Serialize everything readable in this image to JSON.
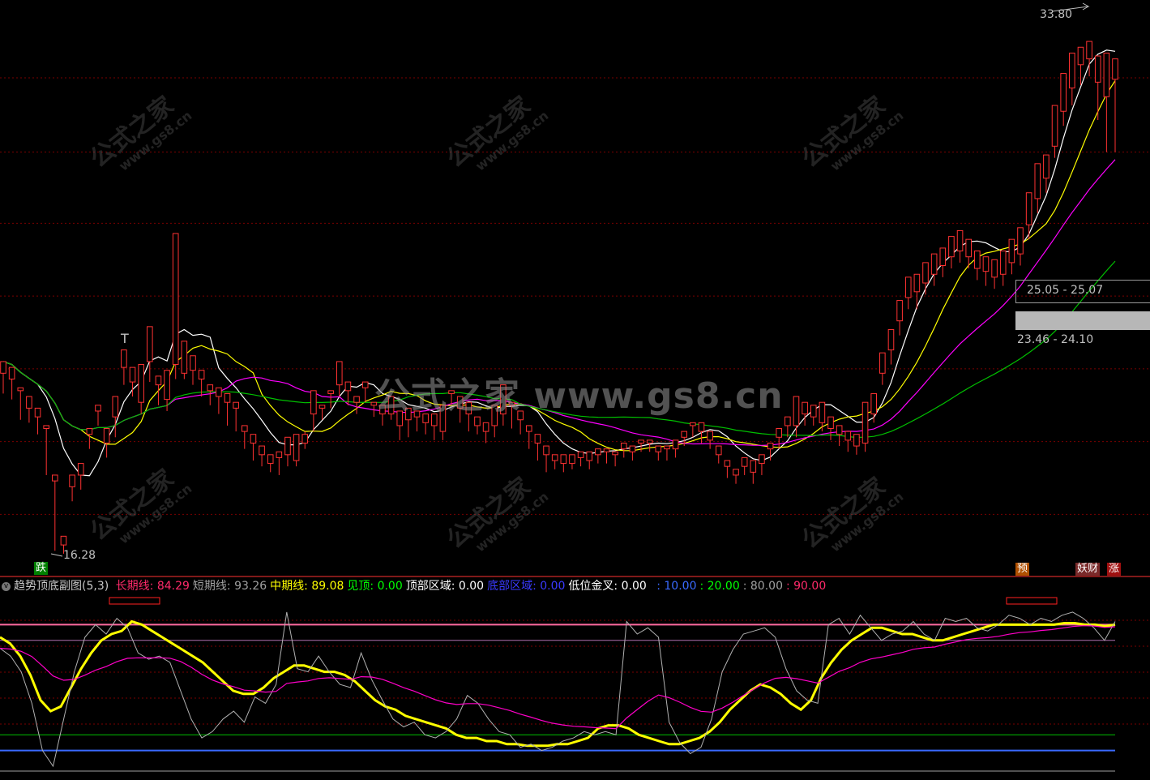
{
  "colors": {
    "background": "#000000",
    "candle_up": "#ff3232",
    "candle_down": "#54ffff",
    "ma5": "#ffffff",
    "ma10": "#ffff00",
    "ma20": "#ff00ff",
    "ma60": "#00c000",
    "grid": "#7a0000",
    "long_line": "#ffff00",
    "short_line": "#c8c8c8",
    "mid_line": "#ff00ff"
  },
  "header_strip_visible": true,
  "watermark": {
    "main": "公式之家 www.gs8.cn",
    "small_cn": "公式之家",
    "small_url": "www.gs8.cn"
  },
  "main_panel": {
    "price_labels": {
      "high": "33.80",
      "low": "16.28",
      "zone_upper": "25.05 - 25.07",
      "zone_lower": "23.46 - 24.10"
    },
    "glyph_T": "T",
    "tags": {
      "fall": "跌",
      "pre": "预",
      "weird_fin": "妖财",
      "rise": "涨"
    },
    "chart_data": {
      "type": "candlestick",
      "y_range": [
        15.5,
        35.0
      ],
      "gridlines": [
        32.55,
        30.0,
        27.55,
        25.05,
        22.55,
        20.05,
        17.55
      ],
      "candles": [
        [
          22.4,
          22.8,
          21.9,
          21.7
        ],
        [
          22.2,
          22.6,
          21.6,
          21.5
        ],
        [
          21.8,
          21.9,
          21.0,
          20.8
        ],
        [
          21.2,
          21.6,
          20.9,
          20.7
        ],
        [
          20.9,
          21.2,
          20.5,
          20.3
        ],
        [
          20.5,
          20.6,
          19.1,
          18.9
        ],
        [
          18.7,
          18.9,
          16.6,
          16.3
        ],
        [
          16.5,
          16.8,
          16.4,
          16.2
        ],
        [
          18.5,
          18.9,
          18.2,
          18.0
        ],
        [
          18.9,
          19.3,
          18.6,
          18.4
        ],
        [
          20.3,
          20.5,
          20.1,
          19.8
        ],
        [
          21.1,
          21.3,
          20.9,
          20.6
        ],
        [
          20.0,
          20.5,
          19.8,
          19.5
        ],
        [
          20.9,
          21.6,
          20.4,
          20.2
        ],
        [
          22.6,
          23.2,
          22.3,
          22.0
        ],
        [
          22.1,
          22.6,
          21.8,
          21.6
        ],
        [
          21.4,
          22.7,
          21.2,
          21.0
        ],
        [
          22.8,
          24.0,
          22.3,
          22.1
        ],
        [
          22.0,
          22.3,
          21.5,
          21.3
        ],
        [
          21.5,
          22.5,
          21.3,
          21.1
        ],
        [
          22.7,
          27.2,
          22.4,
          22.2
        ],
        [
          22.4,
          23.5,
          22.6,
          22.2
        ],
        [
          22.5,
          23.0,
          22.2,
          22.0
        ],
        [
          22.2,
          22.5,
          21.8,
          21.6
        ],
        [
          21.8,
          22.0,
          21.5,
          21.3
        ],
        [
          21.6,
          21.9,
          21.2,
          21.0
        ],
        [
          21.4,
          21.7,
          20.8,
          20.6
        ],
        [
          21.2,
          21.4,
          20.6,
          20.4
        ],
        [
          20.4,
          20.6,
          20.0,
          19.8
        ],
        [
          20.0,
          20.3,
          19.6,
          19.4
        ],
        [
          19.6,
          19.9,
          19.3,
          19.2
        ],
        [
          19.3,
          19.6,
          19.2,
          19.0
        ],
        [
          19.5,
          19.7,
          19.1,
          18.9
        ],
        [
          19.6,
          20.2,
          19.4,
          19.2
        ],
        [
          19.4,
          20.3,
          19.8,
          19.2
        ],
        [
          20.0,
          20.3,
          20.4,
          19.8
        ],
        [
          21.0,
          21.8,
          20.6,
          20.4
        ],
        [
          21.2,
          21.3,
          21.0,
          20.8
        ],
        [
          21.7,
          21.8,
          21.4,
          21.2
        ],
        [
          22.0,
          22.8,
          21.8,
          21.6
        ],
        [
          21.8,
          22.1,
          21.5,
          21.3
        ],
        [
          21.4,
          21.6,
          21.2,
          21.0
        ],
        [
          21.9,
          22.1,
          21.6,
          21.4
        ],
        [
          21.3,
          21.4,
          21.1,
          20.9
        ],
        [
          21.0,
          21.3,
          20.8,
          20.6
        ],
        [
          21.0,
          21.6,
          21.1,
          20.8
        ],
        [
          20.6,
          21.1,
          20.3,
          20.1
        ],
        [
          20.8,
          21.2,
          20.4,
          20.2
        ],
        [
          20.9,
          21.1,
          20.6,
          20.4
        ],
        [
          20.7,
          21.0,
          20.5,
          20.3
        ],
        [
          20.6,
          21.0,
          20.3,
          20.1
        ],
        [
          20.4,
          21.3,
          20.3,
          20.1
        ],
        [
          21.7,
          21.8,
          21.5,
          21.3
        ],
        [
          21.2,
          21.6,
          20.9,
          20.7
        ],
        [
          21.0,
          21.4,
          20.6,
          20.4
        ],
        [
          20.6,
          20.9,
          20.5,
          20.3
        ],
        [
          20.4,
          20.7,
          20.2,
          20.0
        ],
        [
          20.6,
          21.3,
          20.4,
          20.2
        ],
        [
          21.0,
          22.0,
          20.8,
          20.6
        ],
        [
          21.3,
          21.4,
          20.7,
          20.5
        ],
        [
          20.8,
          21.1,
          20.5,
          20.3
        ],
        [
          20.4,
          20.6,
          20.0,
          19.8
        ],
        [
          20.0,
          20.3,
          19.6,
          19.4
        ],
        [
          19.6,
          19.9,
          19.2,
          19.0
        ],
        [
          19.4,
          19.6,
          19.3,
          19.1
        ],
        [
          19.3,
          19.6,
          19.2,
          19.0
        ],
        [
          19.3,
          19.6,
          19.5,
          19.1
        ],
        [
          19.5,
          19.7,
          19.4,
          19.2
        ],
        [
          19.4,
          19.7,
          19.3,
          19.1
        ],
        [
          19.6,
          19.8,
          19.5,
          19.3
        ],
        [
          19.7,
          19.8,
          19.5,
          19.3
        ],
        [
          19.6,
          19.7,
          19.4,
          19.2
        ],
        [
          19.8,
          20.0,
          19.7,
          19.5
        ],
        [
          19.7,
          19.9,
          19.6,
          19.4
        ],
        [
          20.0,
          20.1,
          19.9,
          19.7
        ],
        [
          20.0,
          20.1,
          19.9,
          19.7
        ],
        [
          19.7,
          19.9,
          19.6,
          19.4
        ],
        [
          19.8,
          19.9,
          19.6,
          19.4
        ],
        [
          19.8,
          20.1,
          19.7,
          19.5
        ],
        [
          20.2,
          20.4,
          20.1,
          19.9
        ],
        [
          20.6,
          20.7,
          20.4,
          20.2
        ],
        [
          20.4,
          20.7,
          20.2,
          20.0
        ],
        [
          20.1,
          20.4,
          20.0,
          19.8
        ],
        [
          19.6,
          19.9,
          19.5,
          19.3
        ],
        [
          19.2,
          19.4,
          19.0,
          18.8
        ],
        [
          18.9,
          19.1,
          18.8,
          18.6
        ],
        [
          19.2,
          19.5,
          19.1,
          18.9
        ],
        [
          19.0,
          19.4,
          18.8,
          18.6
        ],
        [
          19.3,
          19.6,
          19.1,
          18.9
        ],
        [
          19.8,
          20.0,
          19.6,
          19.4
        ],
        [
          20.2,
          20.5,
          20.0,
          19.8
        ],
        [
          20.6,
          20.9,
          20.4,
          20.2
        ],
        [
          20.6,
          21.6,
          20.4,
          20.2
        ],
        [
          21.0,
          21.4,
          20.8,
          20.6
        ],
        [
          20.9,
          21.3,
          20.8,
          20.6
        ],
        [
          20.7,
          21.4,
          20.6,
          20.4
        ],
        [
          20.5,
          20.9,
          20.3,
          20.1
        ],
        [
          20.3,
          20.6,
          20.1,
          19.9
        ],
        [
          20.1,
          20.4,
          19.9,
          19.7
        ],
        [
          19.9,
          20.3,
          19.8,
          19.6
        ],
        [
          20.0,
          21.4,
          19.9,
          19.7
        ],
        [
          21.0,
          21.7,
          20.9,
          20.7
        ],
        [
          22.4,
          23.1,
          22.2,
          22.0
        ],
        [
          23.2,
          23.9,
          22.9,
          22.7
        ],
        [
          24.2,
          24.9,
          23.9,
          23.7
        ],
        [
          25.0,
          25.7,
          24.8,
          24.6
        ],
        [
          25.2,
          25.8,
          24.8,
          24.6
        ],
        [
          25.5,
          26.2,
          25.3,
          25.1
        ],
        [
          25.8,
          26.5,
          25.6,
          25.4
        ],
        [
          26.1,
          26.7,
          25.9,
          25.7
        ],
        [
          26.4,
          27.1,
          26.2,
          26.0
        ],
        [
          26.6,
          27.3,
          26.4,
          26.2
        ],
        [
          26.4,
          27.0,
          26.2,
          26.0
        ],
        [
          26.0,
          26.6,
          25.8,
          25.6
        ],
        [
          25.9,
          26.4,
          25.6,
          25.4
        ],
        [
          25.7,
          26.3,
          25.5,
          25.3
        ],
        [
          25.8,
          26.6,
          25.6,
          25.4
        ],
        [
          26.2,
          27.0,
          26.0,
          25.8
        ],
        [
          26.5,
          27.4,
          26.3,
          26.1
        ],
        [
          27.5,
          28.6,
          27.2,
          27.0
        ],
        [
          28.4,
          29.6,
          28.1,
          27.9
        ],
        [
          29.1,
          29.9,
          28.8,
          28.6
        ],
        [
          30.2,
          31.6,
          30.0,
          29.8
        ],
        [
          31.4,
          32.7,
          31.1,
          30.9
        ],
        [
          32.2,
          33.4,
          31.8,
          31.6
        ],
        [
          33.0,
          33.6,
          32.5,
          32.3
        ],
        [
          33.2,
          33.8,
          32.8,
          32.6
        ],
        [
          32.4,
          33.3,
          31.3,
          31.1
        ],
        [
          31.9,
          33.4,
          30.2,
          30.0
        ],
        [
          32.5,
          33.2,
          30.2,
          30.0
        ]
      ]
    }
  },
  "indicator_panel": {
    "title": "趋势顶底副图(5,3)",
    "legend": [
      {
        "label": "长期线:",
        "value": "84.29",
        "color": "#ff2a6a"
      },
      {
        "label": "短期线:",
        "value": "93.26",
        "color": "#a0a0a0"
      },
      {
        "label": "中期线:",
        "value": "89.08",
        "color": "#ffff00"
      },
      {
        "label": "见顶:",
        "value": "0.00",
        "color": "#00ff00"
      },
      {
        "label": "顶部区域:",
        "value": "0.00",
        "color": "#ffffff"
      },
      {
        "label": "底部区域:",
        "value": "0.00",
        "color": "#3a3aff"
      },
      {
        "label": "低位金叉:",
        "value": "0.00",
        "color": "#ffffff"
      }
    ],
    "levels": [
      {
        "value": "10.00",
        "color": "#3a6aff"
      },
      {
        "value": "20.00",
        "color": "#00ff00"
      },
      {
        "value": "80.00",
        "color": "#a0a0a0"
      },
      {
        "value": "90.00",
        "color": "#ff2a6a"
      }
    ],
    "chart_data": {
      "type": "line",
      "y_range": [
        0,
        100
      ],
      "level_lines": [
        90,
        80,
        20,
        10
      ],
      "series": [
        {
          "name": "中期线",
          "color": "#ffff00",
          "values": [
            82,
            78,
            70,
            58,
            42,
            35,
            38,
            50,
            62,
            72,
            80,
            84,
            86,
            92,
            90,
            86,
            82,
            78,
            74,
            70,
            66,
            60,
            54,
            48,
            46,
            46,
            50,
            56,
            60,
            64,
            64,
            62,
            60,
            60,
            58,
            54,
            48,
            42,
            38,
            36,
            32,
            30,
            28,
            26,
            24,
            20,
            18,
            18,
            16,
            16,
            14,
            14,
            13,
            13,
            13,
            14,
            14,
            16,
            18,
            24,
            26,
            26,
            24,
            20,
            18,
            16,
            14,
            14,
            16,
            18,
            22,
            28,
            36,
            42,
            48,
            52,
            50,
            46,
            40,
            36,
            42,
            56,
            66,
            74,
            80,
            84,
            88,
            88,
            86,
            84,
            84,
            82,
            80,
            80,
            82,
            84,
            86,
            88,
            90,
            90,
            90,
            90,
            90,
            90,
            90,
            91,
            91,
            90,
            90,
            89,
            90
          ]
        },
        {
          "name": "短期线",
          "color": "#b0b0b0",
          "values": [
            75,
            70,
            60,
            40,
            10,
            0,
            30,
            60,
            82,
            90,
            84,
            94,
            88,
            72,
            68,
            70,
            66,
            48,
            30,
            18,
            22,
            30,
            35,
            28,
            44,
            40,
            52,
            98,
            62,
            60,
            70,
            60,
            52,
            50,
            72,
            55,
            42,
            30,
            25,
            28,
            20,
            18,
            22,
            30,
            45,
            40,
            30,
            22,
            20,
            12,
            14,
            10,
            12,
            16,
            18,
            22,
            20,
            22,
            20,
            92,
            84,
            88,
            82,
            28,
            15,
            8,
            12,
            30,
            60,
            74,
            84,
            86,
            88,
            82,
            62,
            48,
            42,
            40,
            90,
            94,
            84,
            96,
            88,
            80,
            84,
            86,
            92,
            84,
            80,
            94,
            92,
            94,
            88,
            86,
            90,
            96,
            94,
            90,
            94,
            92,
            96,
            98,
            94,
            88,
            80,
            92
          ]
        }
      ]
    }
  }
}
